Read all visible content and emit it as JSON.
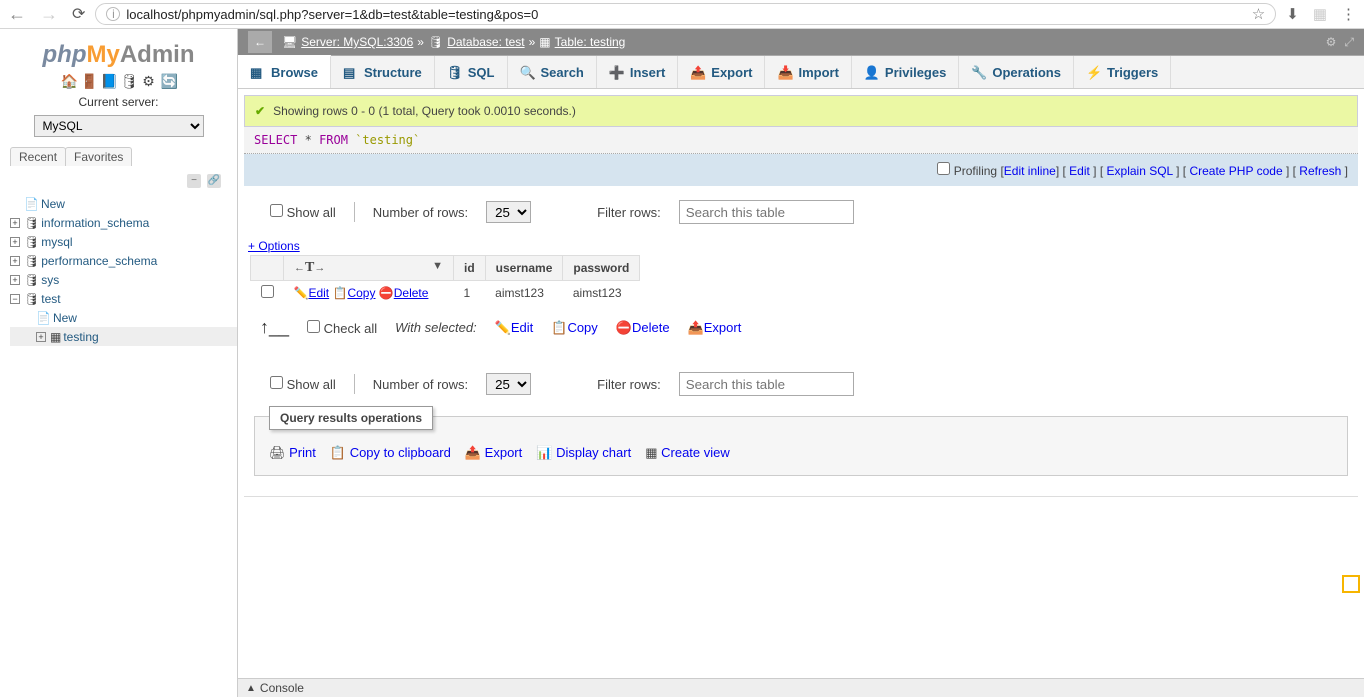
{
  "browser": {
    "url": "localhost/phpmyadmin/sql.php?server=1&db=test&table=testing&pos=0"
  },
  "sidebar": {
    "logo_php": "php",
    "logo_my": "My",
    "logo_admin": "Admin",
    "current_server_label": "Current server:",
    "selected_server": "MySQL",
    "tab_recent": "Recent",
    "tab_favorites": "Favorites",
    "new_label": "New",
    "dbs": [
      "information_schema",
      "mysql",
      "performance_schema",
      "sys",
      "test"
    ],
    "test_children_new": "New",
    "test_children_table": "testing"
  },
  "breadcrumb": {
    "server_label": "Server: MySQL:3306",
    "db_label": "Database: test",
    "table_label": "Table: testing",
    "sep": "»"
  },
  "tabs": [
    {
      "label": "Browse"
    },
    {
      "label": "Structure"
    },
    {
      "label": "SQL"
    },
    {
      "label": "Search"
    },
    {
      "label": "Insert"
    },
    {
      "label": "Export"
    },
    {
      "label": "Import"
    },
    {
      "label": "Privileges"
    },
    {
      "label": "Operations"
    },
    {
      "label": "Triggers"
    }
  ],
  "success_msg": "Showing rows 0 - 0 (1 total, Query took 0.0010 seconds.)",
  "sql": {
    "select": "SELECT",
    "star": "*",
    "from": "FROM",
    "table": "`testing`"
  },
  "profiling": {
    "label": "Profiling",
    "edit_inline": "Edit inline",
    "edit": "Edit",
    "explain": "Explain SQL",
    "create_php": "Create PHP code",
    "refresh": "Refresh"
  },
  "row_controls": {
    "show_all": "Show all",
    "num_rows_label": "Number of rows:",
    "num_rows_value": "25",
    "filter_label": "Filter rows:",
    "filter_placeholder": "Search this table"
  },
  "options_label": "+ Options",
  "table": {
    "cols": [
      "id",
      "username",
      "password"
    ],
    "rows": [
      {
        "id": "1",
        "username": "aimst123",
        "password": "aimst123"
      }
    ],
    "actions": {
      "edit": "Edit",
      "copy": "Copy",
      "delete": "Delete"
    }
  },
  "bulk": {
    "check_all": "Check all",
    "with_selected": "With selected:",
    "edit": "Edit",
    "copy": "Copy",
    "delete": "Delete",
    "export": "Export"
  },
  "qro": {
    "title": "Query results operations",
    "print": "Print",
    "copy_clip": "Copy to clipboard",
    "export": "Export",
    "chart": "Display chart",
    "create_view": "Create view"
  },
  "console_label": "Console"
}
